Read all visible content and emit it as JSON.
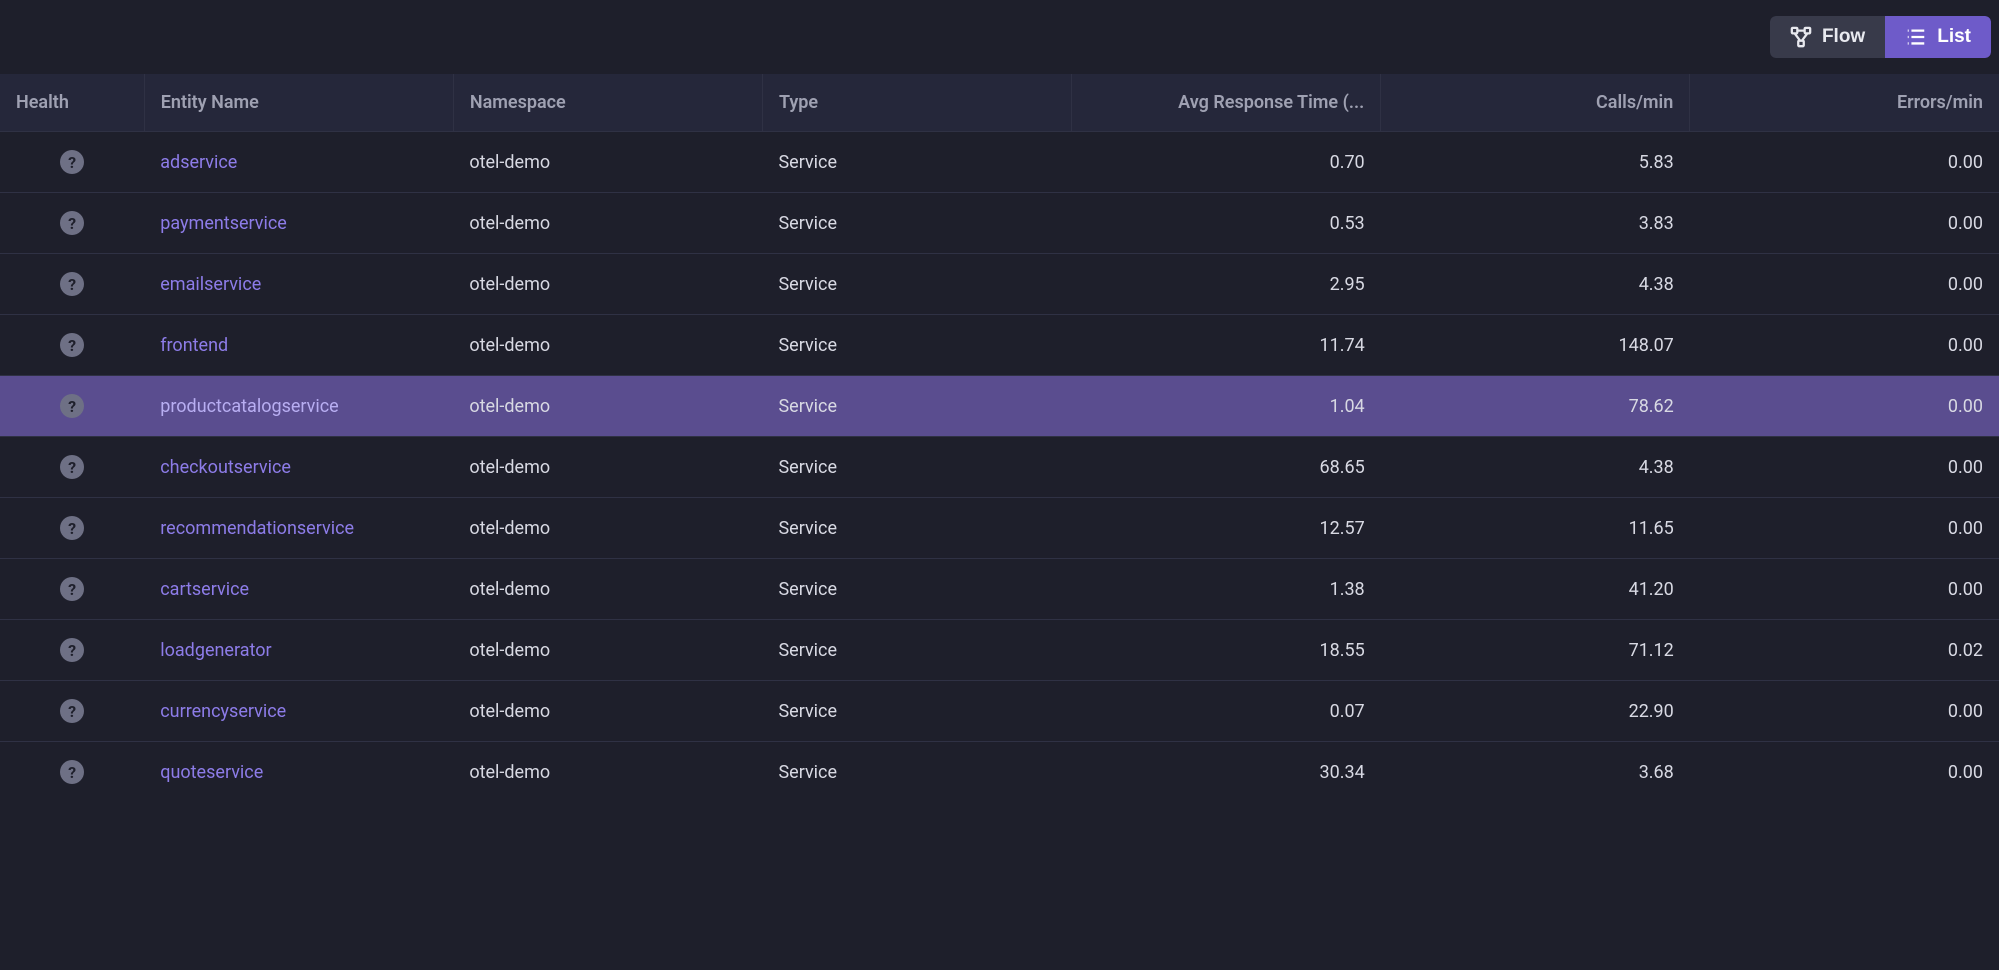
{
  "toolbar": {
    "flow_label": "Flow",
    "list_label": "List"
  },
  "table": {
    "headers": {
      "health": "Health",
      "entity_name": "Entity Name",
      "namespace": "Namespace",
      "type": "Type",
      "avg_response": "Avg Response Time (...",
      "calls_per_min": "Calls/min",
      "errors_per_min": "Errors/min"
    },
    "rows": [
      {
        "health": "?",
        "entity_name": "adservice",
        "namespace": "otel-demo",
        "type": "Service",
        "avg_response": "0.70",
        "calls_per_min": "5.83",
        "errors_per_min": "0.00",
        "highlighted": false
      },
      {
        "health": "?",
        "entity_name": "paymentservice",
        "namespace": "otel-demo",
        "type": "Service",
        "avg_response": "0.53",
        "calls_per_min": "3.83",
        "errors_per_min": "0.00",
        "highlighted": false
      },
      {
        "health": "?",
        "entity_name": "emailservice",
        "namespace": "otel-demo",
        "type": "Service",
        "avg_response": "2.95",
        "calls_per_min": "4.38",
        "errors_per_min": "0.00",
        "highlighted": false
      },
      {
        "health": "?",
        "entity_name": "frontend",
        "namespace": "otel-demo",
        "type": "Service",
        "avg_response": "11.74",
        "calls_per_min": "148.07",
        "errors_per_min": "0.00",
        "highlighted": false
      },
      {
        "health": "?",
        "entity_name": "productcatalogservice",
        "namespace": "otel-demo",
        "type": "Service",
        "avg_response": "1.04",
        "calls_per_min": "78.62",
        "errors_per_min": "0.00",
        "highlighted": true
      },
      {
        "health": "?",
        "entity_name": "checkoutservice",
        "namespace": "otel-demo",
        "type": "Service",
        "avg_response": "68.65",
        "calls_per_min": "4.38",
        "errors_per_min": "0.00",
        "highlighted": false
      },
      {
        "health": "?",
        "entity_name": "recommendationservice",
        "namespace": "otel-demo",
        "type": "Service",
        "avg_response": "12.57",
        "calls_per_min": "11.65",
        "errors_per_min": "0.00",
        "highlighted": false
      },
      {
        "health": "?",
        "entity_name": "cartservice",
        "namespace": "otel-demo",
        "type": "Service",
        "avg_response": "1.38",
        "calls_per_min": "41.20",
        "errors_per_min": "0.00",
        "highlighted": false
      },
      {
        "health": "?",
        "entity_name": "loadgenerator",
        "namespace": "otel-demo",
        "type": "Service",
        "avg_response": "18.55",
        "calls_per_min": "71.12",
        "errors_per_min": "0.02",
        "highlighted": false
      },
      {
        "health": "?",
        "entity_name": "currencyservice",
        "namespace": "otel-demo",
        "type": "Service",
        "avg_response": "0.07",
        "calls_per_min": "22.90",
        "errors_per_min": "0.00",
        "highlighted": false
      },
      {
        "health": "?",
        "entity_name": "quoteservice",
        "namespace": "otel-demo",
        "type": "Service",
        "avg_response": "30.34",
        "calls_per_min": "3.68",
        "errors_per_min": "0.00",
        "highlighted": false
      }
    ]
  }
}
